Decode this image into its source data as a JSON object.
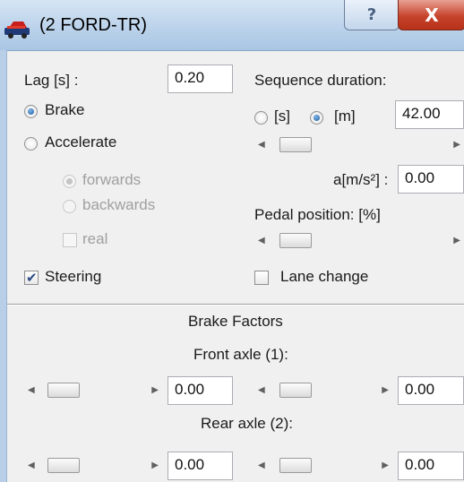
{
  "window": {
    "title": "(2  FORD-TR)",
    "help_glyph": "?",
    "close_glyph": "X"
  },
  "lag": {
    "label": "Lag [s] :",
    "value": "0.20"
  },
  "mode": {
    "brake": "Brake",
    "accelerate": "Accelerate",
    "selected": "Brake"
  },
  "direction": {
    "forwards": "forwards",
    "backwards": "backwards",
    "real": "real",
    "enabled": false,
    "selected": "forwards"
  },
  "steering": {
    "label": "Steering",
    "checked": true
  },
  "sequence": {
    "label": "Sequence duration:",
    "unit_s": "[s]",
    "unit_m": "[m]",
    "selected_unit": "[m]",
    "value": "42.00"
  },
  "accel": {
    "label": "a[m/s²] :",
    "value": "0.00"
  },
  "pedal": {
    "label": "Pedal position: [%]"
  },
  "lane_change": {
    "label": "Lane change",
    "checked": false
  },
  "brake_factors": {
    "title": "Brake Factors",
    "front_axle": {
      "label": "Front axle (1):",
      "left_value": "0.00",
      "right_value": "0.00"
    },
    "rear_axle": {
      "label": "Rear axle (2):",
      "left_value": "0.00",
      "right_value": "0.00"
    }
  },
  "icons": {
    "app": "car-icon",
    "scroll_left": "◀",
    "scroll_right": "▶",
    "check": "✔"
  },
  "colors": {
    "titlebar": "#b9d1ea",
    "close_button": "#c6432c",
    "radio_selected": "#1c5a9c"
  }
}
